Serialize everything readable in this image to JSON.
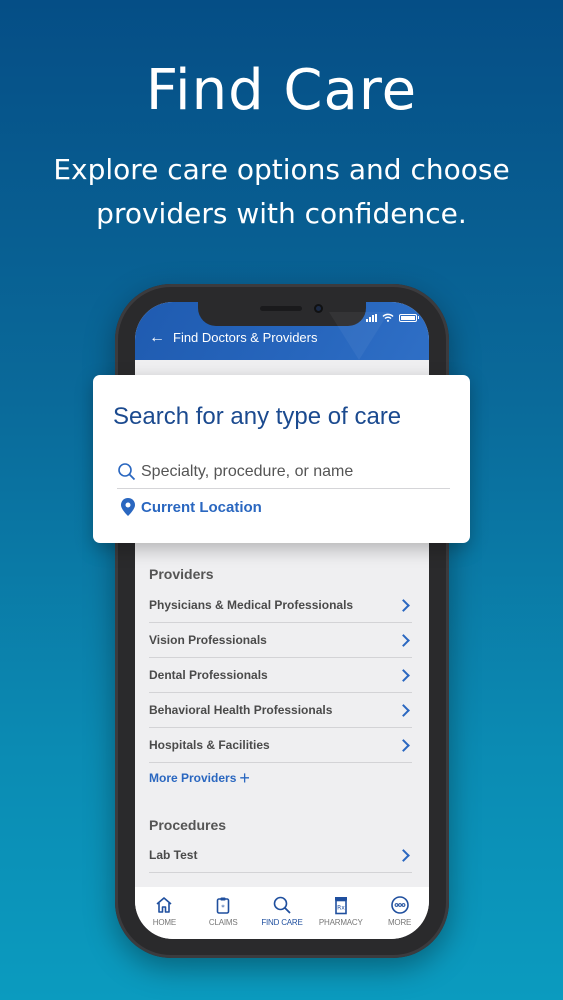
{
  "hero": {
    "title": "Find Care",
    "subtitle_line1": "Explore care options and choose",
    "subtitle_line2": "providers with confidence."
  },
  "app": {
    "nav_title": "Find Doctors & Providers",
    "back_icon": "arrow-left-icon",
    "status_icons": [
      "signal-icon",
      "wifi-icon",
      "battery-icon"
    ]
  },
  "search_card": {
    "title": "Search for any type of care",
    "search_placeholder": "Specialty, procedure, or name",
    "location_label": "Current Location"
  },
  "providers": {
    "heading": "Providers",
    "items": [
      {
        "label": "Physicians & Medical Professionals"
      },
      {
        "label": "Vision Professionals"
      },
      {
        "label": "Dental Professionals"
      },
      {
        "label": "Behavioral Health Professionals"
      },
      {
        "label": "Hospitals & Facilities"
      }
    ],
    "more_label": "More Providers"
  },
  "procedures": {
    "heading": "Procedures",
    "items": [
      {
        "label": "Lab Test"
      }
    ]
  },
  "tabbar": {
    "tabs": [
      {
        "label": "HOME",
        "icon": "home-icon"
      },
      {
        "label": "CLAIMS",
        "icon": "clipboard-icon"
      },
      {
        "label": "FIND CARE",
        "icon": "search-icon",
        "active": true
      },
      {
        "label": "PHARMACY",
        "icon": "pill-bottle-icon"
      },
      {
        "label": "MORE",
        "icon": "more-icon"
      }
    ]
  },
  "colors": {
    "brand_blue": "#2a67c0",
    "header_blue": "#1f5bb0",
    "title_navy": "#1b4a8f",
    "bg_top": "#054e86",
    "bg_bottom": "#0b9bbf"
  }
}
